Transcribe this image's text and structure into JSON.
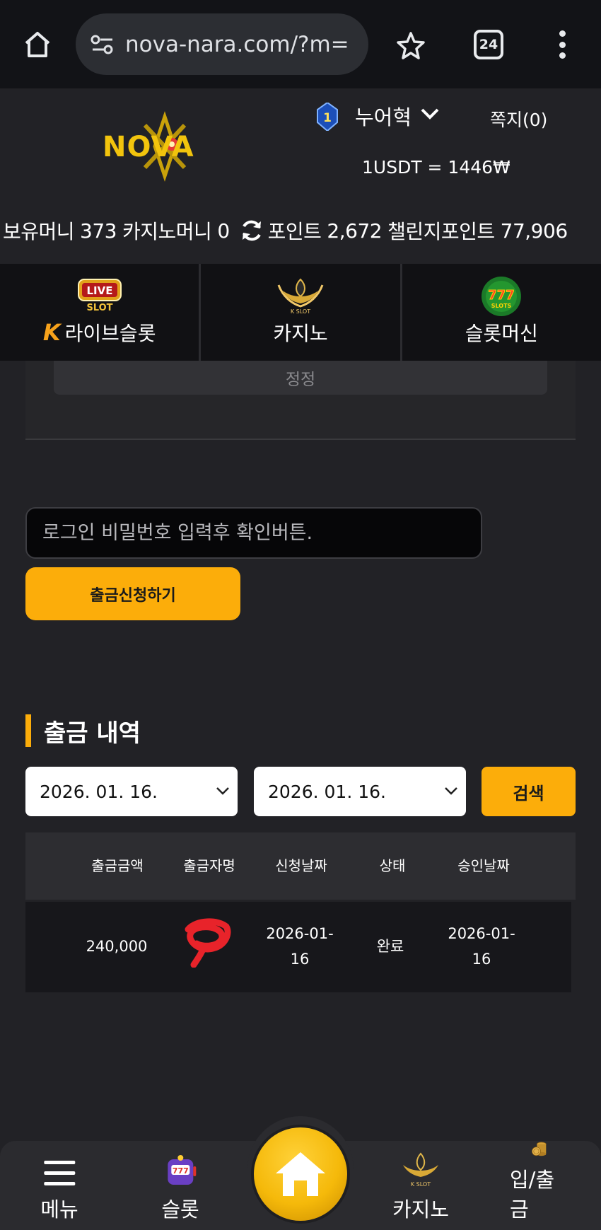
{
  "browser": {
    "url": "nova-nara.com/?m=",
    "tab_count": "24"
  },
  "header": {
    "logo_text": "NOVA",
    "level": "1",
    "username": "누어혁",
    "messages": "쪽지(0)",
    "rate": "1USDT = 1446₩"
  },
  "wallet": {
    "money_label": "보유머니",
    "money_value": "373",
    "casino_label": "카지노머니",
    "casino_value": "0",
    "point_label": "포인트",
    "point_value": "2,672",
    "challenge_label": "챌린지포인트",
    "challenge_value": "77,906"
  },
  "game_tabs": [
    {
      "label": "라이브슬롯",
      "icon": "live-slot-icon",
      "badge": "K"
    },
    {
      "label": "카지노",
      "icon": "k-slot-icon"
    },
    {
      "label": "슬롯머신",
      "icon": "777-slots-icon"
    }
  ],
  "form": {
    "clipped_button": "정정",
    "password_placeholder": "로그인 비밀번호 입력후 확인버튼.",
    "withdraw_button": "출금신청하기"
  },
  "history": {
    "title": "출금 내역",
    "date_from": "2026. 01. 16.",
    "date_to": "2026. 01. 16.",
    "search_button": "검색",
    "columns": [
      "출금금액",
      "출금자명",
      "신청날짜",
      "상태",
      "승인날짜"
    ],
    "rows": [
      {
        "amount": "240,000",
        "name": "",
        "request_date_line1": "2026-01-",
        "request_date_line2": "16",
        "status": "완료",
        "approve_date_line1": "2026-01-",
        "approve_date_line2": "16"
      }
    ]
  },
  "bottom_nav": {
    "menu": "메뉴",
    "slot": "슬롯",
    "home_icon": "home-icon",
    "casino": "카지노",
    "deposit": "입/출금"
  },
  "colors": {
    "accent": "#fcad0a",
    "background": "#222226",
    "chrome": "#121317"
  }
}
